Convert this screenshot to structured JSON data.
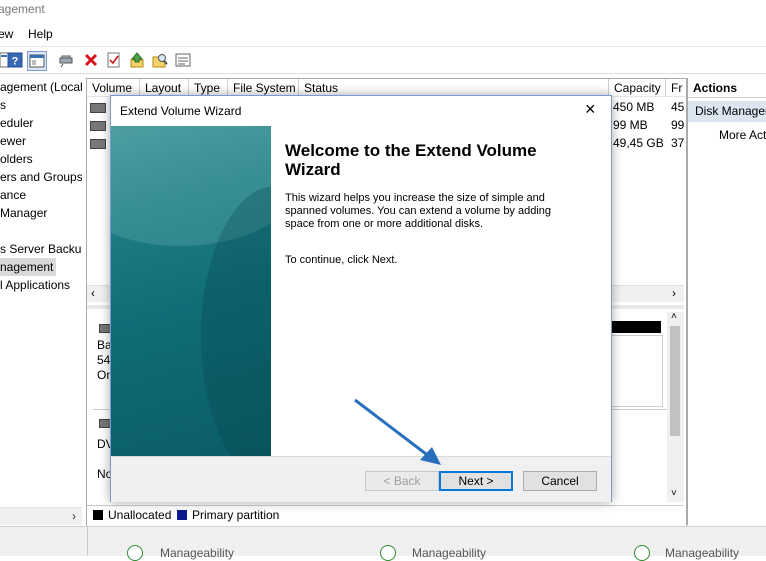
{
  "window": {
    "title": "agement"
  },
  "menu": {
    "view": "ew",
    "help": "Help"
  },
  "toolbar": {
    "icons": [
      "properties-icon",
      "help-icon",
      "show-hide-icon",
      "connect-icon",
      "delete-icon",
      "check-icon",
      "up-icon",
      "search-icon",
      "window-icon"
    ]
  },
  "tree": {
    "items": [
      {
        "label": "agement (Local"
      },
      {
        "label": "s"
      },
      {
        "label": "eduler"
      },
      {
        "label": "ewer"
      },
      {
        "label": "olders"
      },
      {
        "label": "ers and Groups"
      },
      {
        "label": "ance"
      },
      {
        "label": "Manager"
      },
      {
        "label": ""
      },
      {
        "label": "s Server Backup"
      },
      {
        "label": "nagement"
      },
      {
        "label": "l Applications"
      }
    ],
    "selected_index": 10
  },
  "columns": {
    "volume": "Volume",
    "layout": "Layout",
    "type": "Type",
    "fs": "File System",
    "status": "Status",
    "capacity": "Capacity",
    "free": "Fr"
  },
  "rows": [
    {
      "capacity": "450 MB",
      "free": "45"
    },
    {
      "capacity": "99 MB",
      "free": "99"
    },
    {
      "capacity": "49,45 GB",
      "free": "37"
    }
  ],
  "disks": {
    "disk0": {
      "l1": "Ba",
      "l2": "54,",
      "l3": "On"
    },
    "disk1": {
      "l1": "DV",
      "l2": "No"
    }
  },
  "legend": {
    "unallocated": "Unallocated",
    "primary": "Primary partition"
  },
  "actions": {
    "header": "Actions",
    "item": "Disk Manager",
    "more": "More Act"
  },
  "status": {
    "text1": "Manageability",
    "text2": "Manageability",
    "text3": "Manageability"
  },
  "wizard": {
    "title": "Extend Volume Wizard",
    "heading": "Welcome to the Extend Volume Wizard",
    "description": "This wizard helps you increase the size of simple and spanned volumes. You can extend a volume  by adding space from one or more additional disks.",
    "continue": "To continue, click Next.",
    "back_label": "< Back",
    "next_label": "Next >",
    "cancel_label": "Cancel"
  },
  "colors": {
    "accent": "#0078d7",
    "arrow": "#2a6fbd",
    "wizard_side": "#106c75"
  }
}
